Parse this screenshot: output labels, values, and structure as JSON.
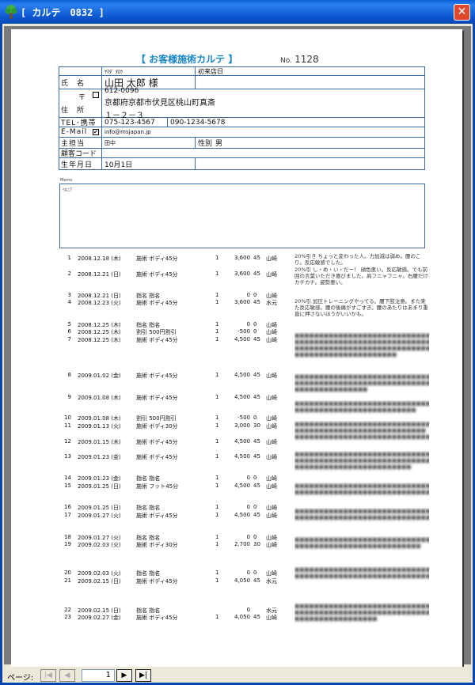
{
  "window": {
    "title": "[ カルテ　0832 ]",
    "close_label": "✕"
  },
  "sheet": {
    "title": "【 お客様施術カルテ 】",
    "no_label": "No.",
    "no_value": "1128",
    "furigana": "ﾔﾏﾀﾞ ﾀﾛｳ",
    "first_visit_label": "初来店日",
    "name_label": "氏　名",
    "name_value": "山田 太郎 様",
    "address_label": "住　所",
    "postal_mark": "〒",
    "postal": "612-0096",
    "address1": "京都府京都市伏見区桃山町真斎",
    "address2": "１－２－３",
    "tel_label": "TEL･携帯",
    "tel": "075-123-4567",
    "mobile": "090-1234-5678",
    "email_label": "E-Mail",
    "email": "info@msjapan.jp",
    "staff_label": "主担当",
    "staff": "田中",
    "gender_label": "性別",
    "gender": "男",
    "code_label": "顧客コード",
    "code": "",
    "birthday_label": "生年月日",
    "birthday": "10月1日",
    "memo_label": "Memo",
    "memo": "ﾍﾙﾆｱ"
  },
  "records": [
    {
      "n": "1",
      "date": "2008.12.18 (木)",
      "menu": "施術 ボディ45分",
      "qty": "1",
      "price": "3,600",
      "time": "45",
      "staff": "山崎"
    },
    {
      "n": "2",
      "date": "2008.12.21 (日)",
      "menu": "施術 ボディ45分",
      "qty": "1",
      "price": "3,600",
      "time": "45",
      "staff": "山崎"
    },
    {
      "n": "3",
      "date": "2008.12.21 (日)",
      "menu": "指名 指名",
      "qty": "1",
      "price": "0",
      "time": "0",
      "staff": "山崎"
    },
    {
      "n": "4",
      "date": "2008.12.23 (火)",
      "menu": "施術 ボディ45分",
      "qty": "1",
      "price": "3,600",
      "time": "45",
      "staff": "水元"
    },
    {
      "n": "5",
      "date": "2008.12.25 (木)",
      "menu": "指名 指名",
      "qty": "1",
      "price": "0",
      "time": "0",
      "staff": "山崎"
    },
    {
      "n": "6",
      "date": "2008.12.25 (木)",
      "menu": "割引 500円割引",
      "qty": "1",
      "price": "-500",
      "time": "0",
      "staff": "山崎"
    },
    {
      "n": "7",
      "date": "2008.12.25 (木)",
      "menu": "施術 ボディ45分",
      "qty": "1",
      "price": "4,500",
      "time": "45",
      "staff": "山崎"
    },
    {
      "n": "8",
      "date": "2009.01.02 (金)",
      "menu": "施術 ボディ45分",
      "qty": "1",
      "price": "4,500",
      "time": "45",
      "staff": "山崎"
    },
    {
      "n": "9",
      "date": "2009.01.08 (木)",
      "menu": "施術 ボディ45分",
      "qty": "1",
      "price": "4,500",
      "time": "45",
      "staff": "山崎"
    },
    {
      "n": "10",
      "date": "2009.01.08 (木)",
      "menu": "割引 500円割引",
      "qty": "1",
      "price": "-500",
      "time": "0",
      "staff": "山崎"
    },
    {
      "n": "11",
      "date": "2009.01.13 (火)",
      "menu": "施術 ボディ30分",
      "qty": "1",
      "price": "3,000",
      "time": "30",
      "staff": "山崎"
    },
    {
      "n": "12",
      "date": "2009.01.15 (木)",
      "menu": "施術 ボディ45分",
      "qty": "1",
      "price": "4,500",
      "time": "45",
      "staff": "山崎"
    },
    {
      "n": "13",
      "date": "2009.01.23 (金)",
      "menu": "施術 ボディ45分",
      "qty": "1",
      "price": "4,500",
      "time": "45",
      "staff": "山崎"
    },
    {
      "n": "14",
      "date": "2009.01.23 (金)",
      "menu": "指名 指名",
      "qty": "1",
      "price": "0",
      "time": "0",
      "staff": "山崎"
    },
    {
      "n": "15",
      "date": "2009.01.25 (日)",
      "menu": "施術 フット45分",
      "qty": "1",
      "price": "4,500",
      "time": "45",
      "staff": "山崎"
    },
    {
      "n": "16",
      "date": "2009.01.25 (日)",
      "menu": "指名 指名",
      "qty": "1",
      "price": "0",
      "time": "0",
      "staff": "山崎"
    },
    {
      "n": "17",
      "date": "2009.01.27 (火)",
      "menu": "施術 ボディ45分",
      "qty": "1",
      "price": "4,500",
      "time": "45",
      "staff": "山崎"
    },
    {
      "n": "18",
      "date": "2009.01.27 (火)",
      "menu": "指名 指名",
      "qty": "1",
      "price": "0",
      "time": "0",
      "staff": "山崎"
    },
    {
      "n": "19",
      "date": "2009.02.03 (火)",
      "menu": "施術 ボディ30分",
      "qty": "1",
      "price": "2,700",
      "time": "30",
      "staff": "山崎"
    },
    {
      "n": "20",
      "date": "2009.02.03 (火)",
      "menu": "指名 指名",
      "qty": "1",
      "price": "0",
      "time": "0",
      "staff": "山崎"
    },
    {
      "n": "21",
      "date": "2009.02.15 (日)",
      "menu": "施術 ボディ45分",
      "qty": "1",
      "price": "4,050",
      "time": "45",
      "staff": "水元"
    },
    {
      "n": "22",
      "date": "2009.02.15 (日)",
      "menu": "指名 指名",
      "qty": "",
      "price": "0",
      "time": "",
      "staff": "水元"
    },
    {
      "n": "23",
      "date": "2009.02.27 (金)",
      "menu": "施術 ボディ45分",
      "qty": "1",
      "price": "4,050",
      "time": "45",
      "staff": "山崎"
    }
  ],
  "notes": [
    "20%引き ちょっと変わった人。力加減は弱め。腰のこり。反応敏感でした。",
    "20%引 し・め・い・だー！ 顔色悪い。反応敏感。でも前回の言葉いただき喜びました。肩フニャフニャ。右腰だけカチカチ。姿勢悪い。",
    "20%引 加圧トレーニングやってる。腰下肢注意。また来た反応敏感。腰の後痛がすごすぎ。腰のあたりはあまり重直に押さないほうがいいかも。"
  ],
  "pager": {
    "label": "ページ:",
    "value": "1"
  }
}
